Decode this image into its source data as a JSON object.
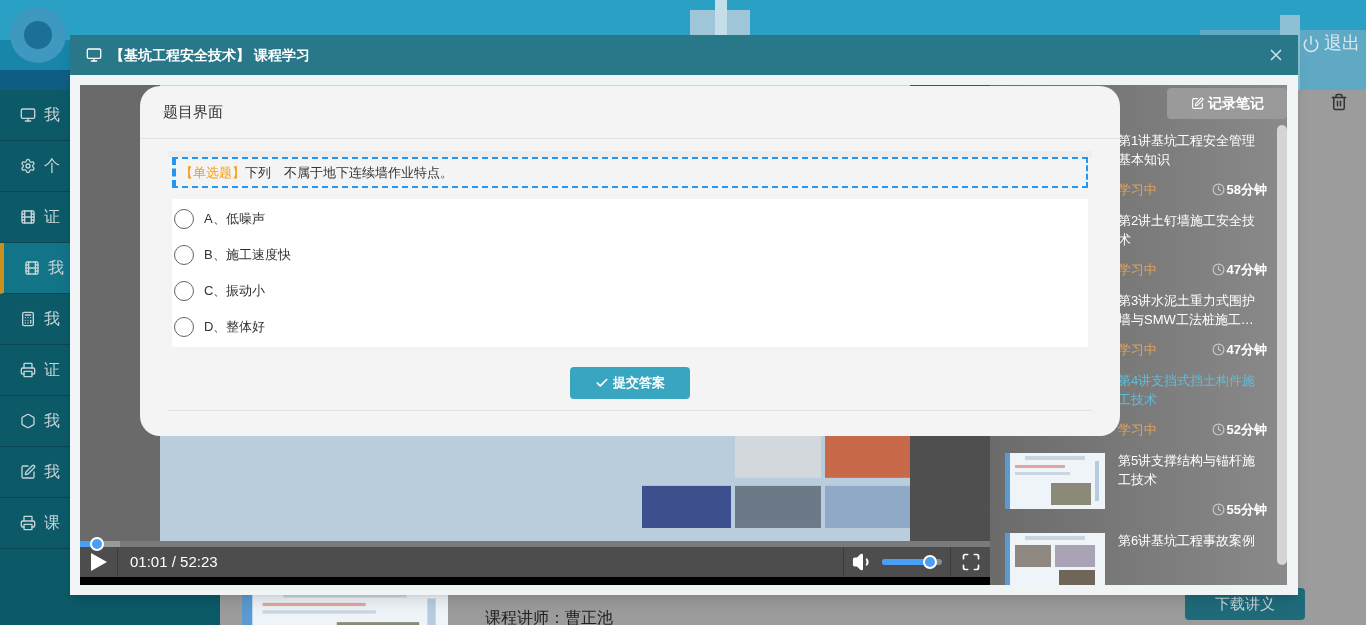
{
  "page": {
    "logout": "退出",
    "sidebar": [
      {
        "kind": "monitor",
        "label": "我",
        "selected": false
      },
      {
        "kind": "gear",
        "label": "个",
        "selected": false
      },
      {
        "kind": "film",
        "label": "证",
        "selected": false
      },
      {
        "kind": "film",
        "label": "我",
        "selected": true
      },
      {
        "kind": "calculator",
        "label": "我",
        "selected": false
      },
      {
        "kind": "printer",
        "label": "证",
        "selected": false
      },
      {
        "kind": "hexagon",
        "label": "我",
        "selected": false
      },
      {
        "kind": "edit",
        "label": "我",
        "selected": false
      },
      {
        "kind": "printer",
        "label": "课",
        "selected": false
      }
    ],
    "teacher": "课程讲师：曹正池",
    "download_button": "下载讲义"
  },
  "dialog": {
    "title": "【基坑工程安全技术】 课程学习",
    "quiz": {
      "title": "题目界面",
      "question_type": "【单选题】",
      "question": "下列　不属于地下连续墙作业特点。",
      "options": [
        {
          "label": "A、低噪声",
          "selected": false
        },
        {
          "label": "B、施工速度快",
          "selected": false
        },
        {
          "label": "C、振动小",
          "selected": false
        },
        {
          "label": "D、整体好",
          "selected": false
        }
      ],
      "submit": "提交答案"
    },
    "player": {
      "progress": {
        "level": 0.019
      },
      "time": "01:01 / 52:23",
      "volume": {
        "level": 0.8
      }
    },
    "note_button": "记录笔记",
    "lessons": [
      {
        "title": "第1讲基坑工程安全管理基本知识",
        "status": "学习中",
        "duration": "58分钟",
        "selected": false
      },
      {
        "title": "第2讲土钉墙施工安全技术",
        "status": "学习中",
        "duration": "47分钟",
        "selected": false
      },
      {
        "title": "第3讲水泥土重力式围护墙与SMW工法桩施工…",
        "status": "学习中",
        "duration": "47分钟",
        "selected": false
      },
      {
        "title": "第4讲支挡式挡土构件施工技术",
        "status": "学习中",
        "duration": "52分钟",
        "selected": true
      },
      {
        "title": "第5讲支撑结构与锚杆施工技术",
        "duration": "55分钟",
        "selected": false
      },
      {
        "title": "第6讲基坑工程事故案例",
        "selected": false
      }
    ]
  }
}
